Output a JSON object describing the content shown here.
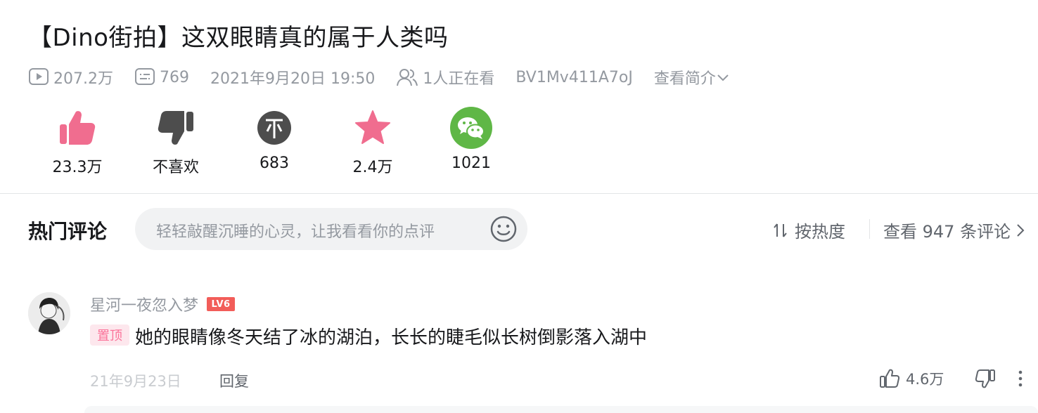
{
  "video": {
    "title": "【Dino街拍】这双眼睛真的属于人类吗"
  },
  "meta": {
    "views": "207.2万",
    "danmaku": "769",
    "pubdate": "2021年9月20日 19:50",
    "watching": "1人正在看",
    "bvid": "BV1Mv411A7oJ",
    "intro_label": "查看简介"
  },
  "actions": [
    {
      "icon": "thumb-up-icon",
      "label": "23.3万",
      "color": "#f06d8f"
    },
    {
      "icon": "thumb-down-icon",
      "label": "不喜欢",
      "color": "#4d4d4d"
    },
    {
      "icon": "coin-icon",
      "label": "683",
      "color": "#4d4d4d"
    },
    {
      "icon": "star-icon",
      "label": "2.4万",
      "color": "#f06d8f"
    },
    {
      "icon": "wechat-icon",
      "label": "1021",
      "color": "#5fb746"
    }
  ],
  "comments": {
    "title": "热门评论",
    "placeholder": "轻轻敲醒沉睡的心灵，让我看看你的点评",
    "sort_label": "按热度",
    "view_all": "查看 947 条评论"
  },
  "top_comment": {
    "user": "星河一夜忽入梦",
    "level": "LV6",
    "pin_label": "置顶",
    "text": "她的眼睛像冬天结了冰的湖泊，长长的睫毛似长树倒影落入湖中",
    "date": "21年9月23日",
    "reply_label": "回复",
    "likes": "4.6万"
  },
  "colors": {
    "accent_pink": "#fb7299",
    "text_primary": "#18191c",
    "text_secondary": "#9499a0",
    "level_red": "#f25d59",
    "wechat_green": "#5fb746"
  }
}
